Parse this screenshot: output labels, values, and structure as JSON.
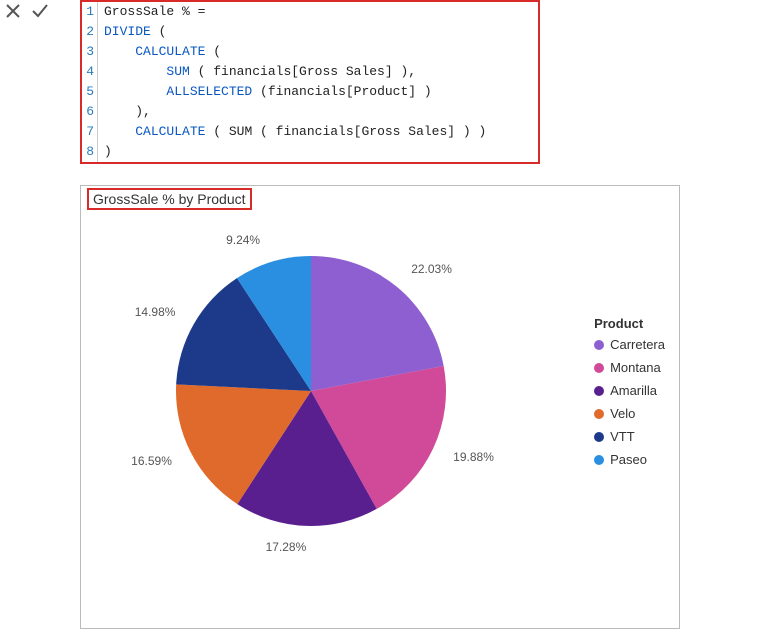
{
  "actions": {
    "cancel_icon": "close-icon",
    "commit_icon": "check-icon"
  },
  "formula": {
    "lines": [
      {
        "n": "1",
        "pre": "",
        "kw": "",
        "txt": "GrossSale % ="
      },
      {
        "n": "2",
        "pre": "",
        "kw": "DIVIDE",
        "txt": " ("
      },
      {
        "n": "3",
        "pre": "    ",
        "kw": "CALCULATE",
        "txt": " ("
      },
      {
        "n": "4",
        "pre": "        ",
        "kw": "SUM",
        "txt": " ( financials[Gross Sales] ),"
      },
      {
        "n": "5",
        "pre": "        ",
        "kw": "ALLSELECTED",
        "txt": " (financials[Product] )"
      },
      {
        "n": "6",
        "pre": "    ",
        "kw": "",
        "txt": "),"
      },
      {
        "n": "7",
        "pre": "    ",
        "kw": "CALCULATE",
        "txt": " ( SUM ( financials[Gross Sales] ) )"
      },
      {
        "n": "8",
        "pre": "",
        "kw": "",
        "txt": ")"
      }
    ]
  },
  "chart": {
    "title": "GrossSale % by Product",
    "legend_title": "Product"
  },
  "chart_data": {
    "type": "pie",
    "title": "GrossSale % by Product",
    "categories": [
      "Carretera",
      "Montana",
      "Amarilla",
      "Velo",
      "VTT",
      "Paseo"
    ],
    "values": [
      22.03,
      19.88,
      17.28,
      16.59,
      14.98,
      9.24
    ],
    "colors": [
      "#8e5fd0",
      "#d14a9a",
      "#5a1f8e",
      "#e06a2b",
      "#1d3a8a",
      "#2a8fe0"
    ],
    "labels": [
      "22.03%",
      "19.88%",
      "17.28%",
      "16.59%",
      "14.98%",
      "9.24%"
    ],
    "legend_position": "right"
  }
}
